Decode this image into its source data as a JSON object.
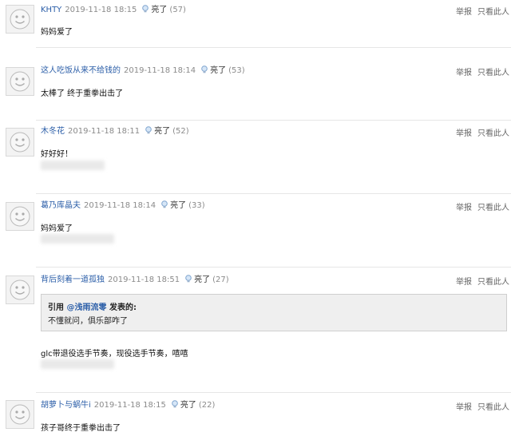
{
  "actions": {
    "report": "举报",
    "only_this_user": "只看此人"
  },
  "like_label": "亮了",
  "posts": [
    {
      "user": "KHTY",
      "date": "2019-11-18 18:15",
      "count": "(57)",
      "text": "妈妈爱了"
    },
    {
      "user": "这人吃饭从来不给钱的",
      "date": "2019-11-18 18:14",
      "count": "(53)",
      "text": "太棒了 终于重拳出击了"
    },
    {
      "user": "木冬花",
      "date": "2019-11-18 18:11",
      "count": "(52)",
      "text": "好好好！"
    },
    {
      "user": "葛乃库晶夫",
      "date": "2019-11-18 18:14",
      "count": "(33)",
      "text": "妈妈爱了"
    },
    {
      "user": "背后刻着一道孤独",
      "date": "2019-11-18 18:51",
      "count": "(27)",
      "text": "glc带退役选手节奏，现役选手节奏，嘻嘻",
      "quote": {
        "prefix": "引用",
        "user": "@浅雨流零",
        "suffix": "发表的:",
        "text": "不懂就问，俱乐部咋了"
      }
    },
    {
      "user": "胡萝卜与蜗牛i",
      "date": "2019-11-18 18:15",
      "count": "(22)",
      "text": "孩子哥终于重拳出击了"
    }
  ]
}
